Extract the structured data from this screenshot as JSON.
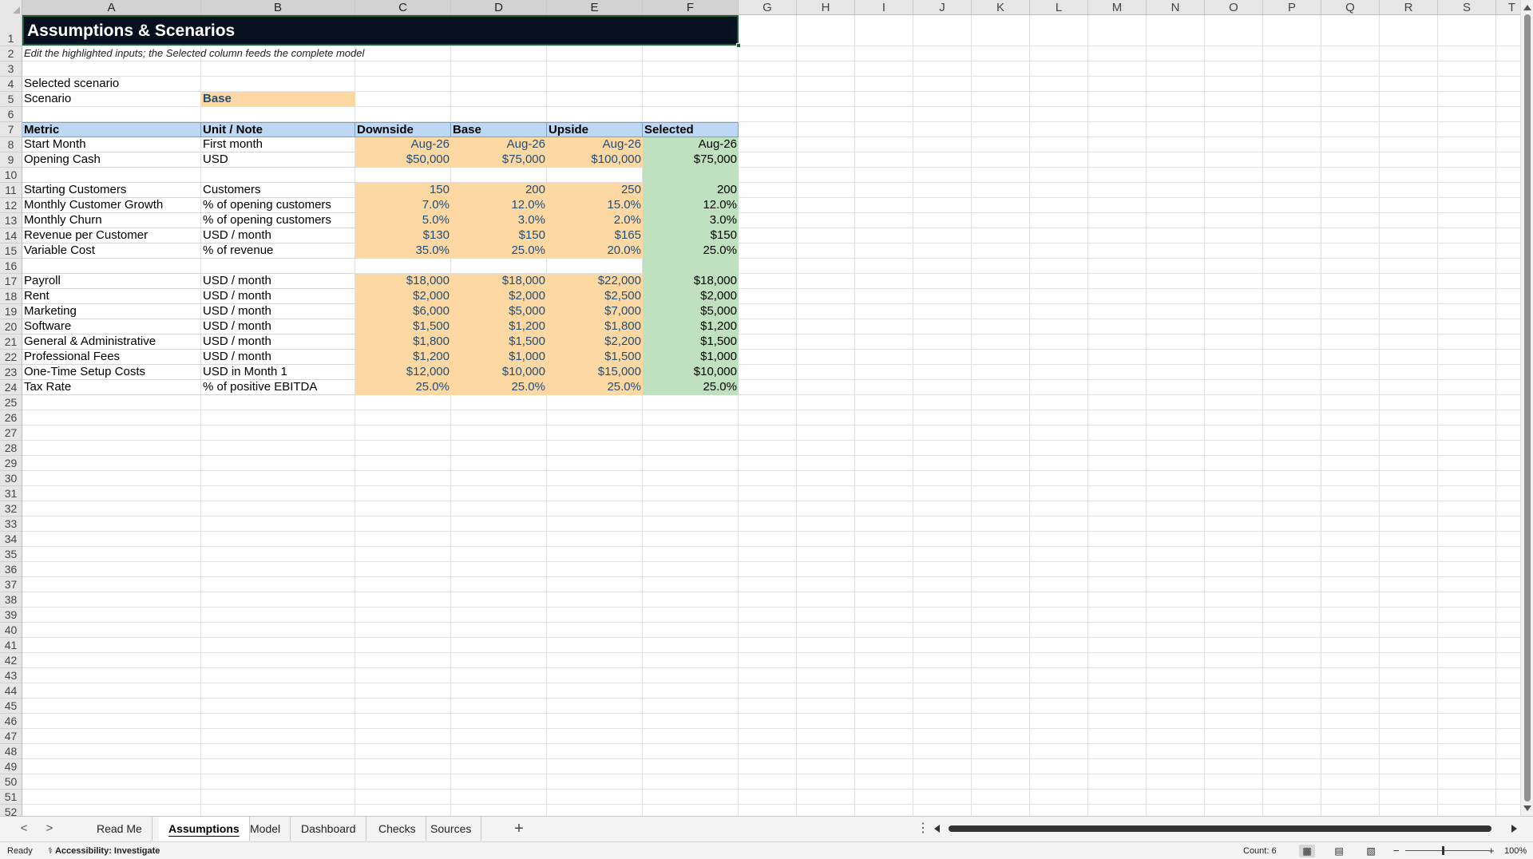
{
  "columns": [
    "A",
    "B",
    "C",
    "D",
    "E",
    "F",
    "G",
    "H",
    "I",
    "J",
    "K",
    "L",
    "M",
    "N",
    "O",
    "P",
    "Q",
    "R",
    "S",
    "T"
  ],
  "rows": [
    "1",
    "2",
    "3",
    "4",
    "5",
    "6",
    "7",
    "8",
    "9",
    "10",
    "11",
    "12",
    "13",
    "14",
    "15",
    "16",
    "17",
    "18",
    "19",
    "20",
    "21",
    "22",
    "23",
    "24",
    "25",
    "26",
    "27",
    "28",
    "29",
    "30",
    "31",
    "32",
    "33",
    "34",
    "35",
    "36",
    "37",
    "38",
    "39",
    "40",
    "41",
    "42",
    "43",
    "44",
    "45",
    "46",
    "47",
    "48",
    "49",
    "50",
    "51",
    "52"
  ],
  "sheet": {
    "title": "Assumptions & Scenarios",
    "subtitle": "Edit the highlighted inputs; the Selected column feeds the complete model",
    "selector_heading": "Selected scenario",
    "scenario_label": "Scenario",
    "scenario_value": "Base",
    "table_headers": [
      "Metric",
      "Unit / Note",
      "Downside",
      "Base",
      "Upside",
      "Selected"
    ],
    "table_rows": [
      {
        "metric": "Start Month",
        "unit": "First month",
        "downside": "Aug-26",
        "base": "Aug-26",
        "upside": "Aug-26",
        "selected": "Aug-26"
      },
      {
        "metric": "Opening Cash",
        "unit": "USD",
        "downside": "$50,000",
        "base": "$75,000",
        "upside": "$100,000",
        "selected": "$75,000"
      },
      {
        "metric": "",
        "unit": "",
        "downside": "",
        "base": "",
        "upside": "",
        "selected": ""
      },
      {
        "metric": "Starting Customers",
        "unit": "Customers",
        "downside": "150",
        "base": "200",
        "upside": "250",
        "selected": "200"
      },
      {
        "metric": "Monthly Customer Growth",
        "unit": "% of opening customers",
        "downside": "7.0%",
        "base": "12.0%",
        "upside": "15.0%",
        "selected": "12.0%"
      },
      {
        "metric": "Monthly Churn",
        "unit": "% of opening customers",
        "downside": "5.0%",
        "base": "3.0%",
        "upside": "2.0%",
        "selected": "3.0%"
      },
      {
        "metric": "Revenue per Customer",
        "unit": "USD / month",
        "downside": "$130",
        "base": "$150",
        "upside": "$165",
        "selected": "$150"
      },
      {
        "metric": "Variable Cost",
        "unit": "% of revenue",
        "downside": "35.0%",
        "base": "25.0%",
        "upside": "20.0%",
        "selected": "25.0%"
      },
      {
        "metric": "",
        "unit": "",
        "downside": "",
        "base": "",
        "upside": "",
        "selected": ""
      },
      {
        "metric": "Payroll",
        "unit": "USD / month",
        "downside": "$18,000",
        "base": "$18,000",
        "upside": "$22,000",
        "selected": "$18,000"
      },
      {
        "metric": "Rent",
        "unit": "USD / month",
        "downside": "$2,000",
        "base": "$2,000",
        "upside": "$2,500",
        "selected": "$2,000"
      },
      {
        "metric": "Marketing",
        "unit": "USD / month",
        "downside": "$6,000",
        "base": "$5,000",
        "upside": "$7,000",
        "selected": "$5,000"
      },
      {
        "metric": "Software",
        "unit": "USD / month",
        "downside": "$1,500",
        "base": "$1,200",
        "upside": "$1,800",
        "selected": "$1,200"
      },
      {
        "metric": "General & Administrative",
        "unit": "USD / month",
        "downside": "$1,800",
        "base": "$1,500",
        "upside": "$2,200",
        "selected": "$1,500"
      },
      {
        "metric": "Professional Fees",
        "unit": "USD / month",
        "downside": "$1,200",
        "base": "$1,000",
        "upside": "$1,500",
        "selected": "$1,000"
      },
      {
        "metric": "One-Time Setup Costs",
        "unit": "USD in Month 1",
        "downside": "$12,000",
        "base": "$10,000",
        "upside": "$15,000",
        "selected": "$10,000"
      },
      {
        "metric": "Tax Rate",
        "unit": "% of positive EBITDA",
        "downside": "25.0%",
        "base": "25.0%",
        "upside": "25.0%",
        "selected": "25.0%"
      }
    ]
  },
  "tabs": {
    "nav_prev": "<",
    "nav_next": ">",
    "items": [
      "Read Me",
      "Assumptions",
      "Model",
      "Dashboard",
      "Checks",
      "Sources"
    ],
    "active": "Assumptions",
    "add": "+",
    "menu": "⋮"
  },
  "status": {
    "ready": "Ready",
    "accessibility": "Accessibility: Investigate",
    "count": "Count: 6",
    "zoom_minus": "−",
    "zoom_plus": "+",
    "zoom": "100%"
  },
  "icons": {
    "accessibility": "accessibility-icon",
    "normal_view": "normal-view-icon",
    "page_layout": "page-layout-icon",
    "page_break": "page-break-preview-icon"
  },
  "colors": {
    "title_bg": "#06101f",
    "header_bg": "#bcd8f5",
    "input_bg": "#fed8a3",
    "input_text": "#1f4e79",
    "selected_bg": "#bfe1bf"
  }
}
